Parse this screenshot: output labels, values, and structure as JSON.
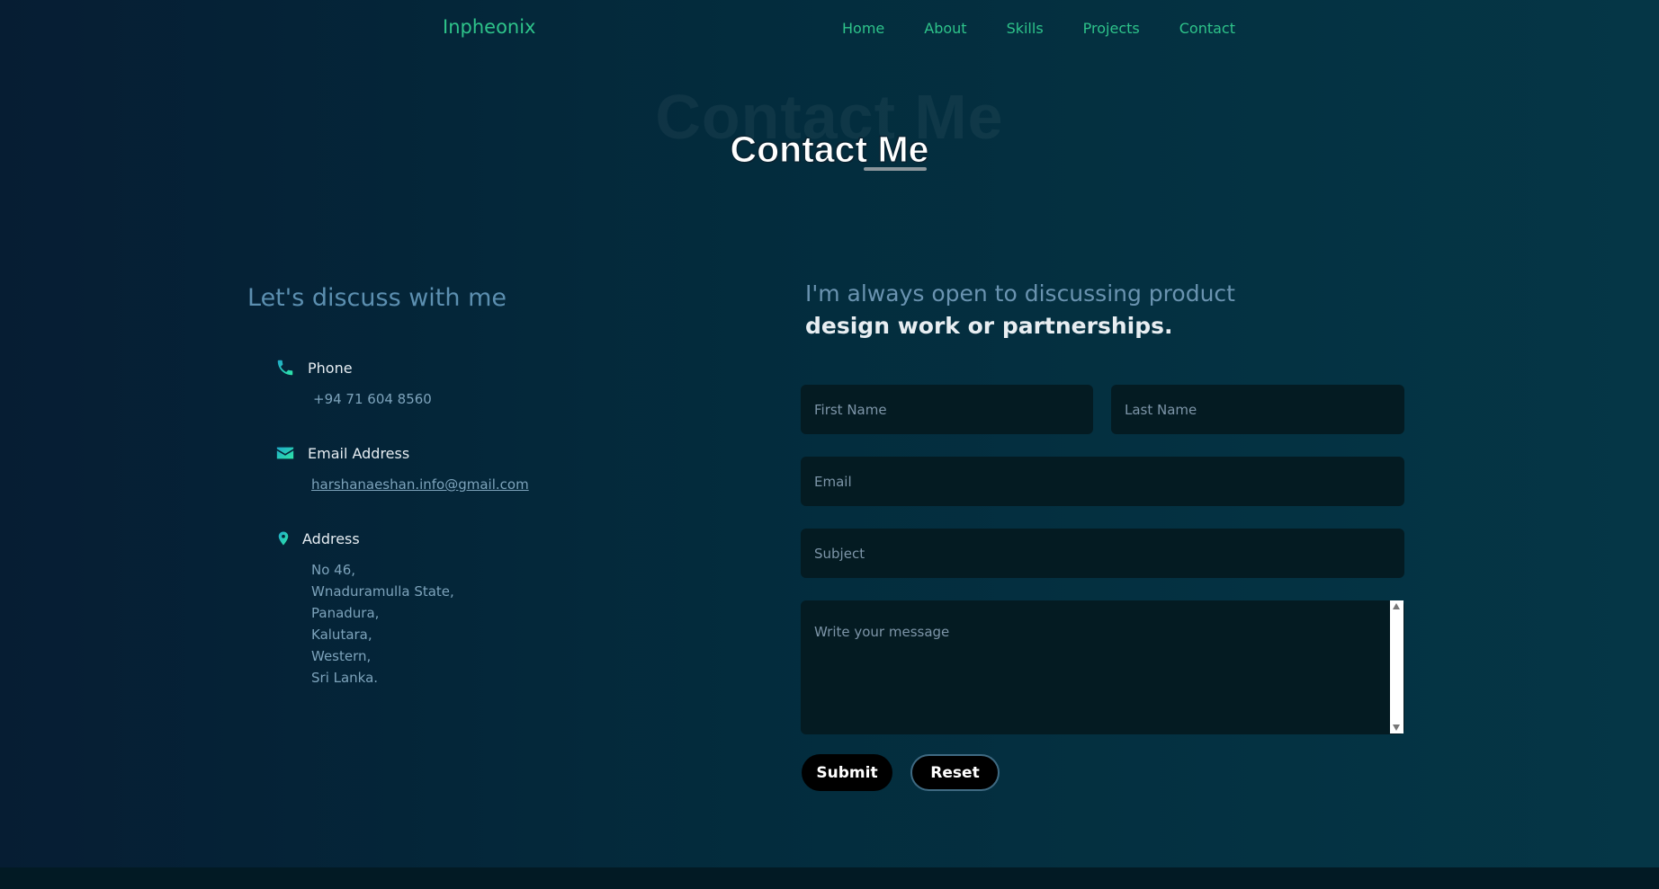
{
  "header": {
    "brand": "Inpheonix",
    "nav": [
      "Home",
      "About",
      "Skills",
      "Projects",
      "Contact"
    ]
  },
  "hero": {
    "bg_text": "Contact Me",
    "title": "Contact Me"
  },
  "contact_info": {
    "heading": "Let's discuss with me",
    "phone": {
      "label": "Phone",
      "value": "+94 71 604 8560",
      "icon": "phone-icon"
    },
    "email": {
      "label": "Email Address",
      "value": "harshanaeshan.info@gmail.com",
      "icon": "envelope-icon"
    },
    "address": {
      "label": "Address",
      "icon": "map-pin-icon",
      "lines": [
        "No 46,",
        "Wnaduramulla State,",
        "Panadura,",
        "Kalutara,",
        "Western,",
        "Sri Lanka."
      ]
    }
  },
  "form": {
    "tagline_line1": "I'm always open to discussing product",
    "tagline_line2": "design work or partnerships.",
    "first_name_placeholder": "First Name",
    "last_name_placeholder": "Last Name",
    "email_placeholder": "Email",
    "subject_placeholder": "Subject",
    "message_placeholder": "Write your message",
    "submit_label": "Submit",
    "reset_label": "Reset"
  },
  "colors": {
    "accent": "#2ec38a",
    "icon_gradient_start": "#1fa9c9",
    "icon_gradient_end": "#2ee6a6"
  }
}
